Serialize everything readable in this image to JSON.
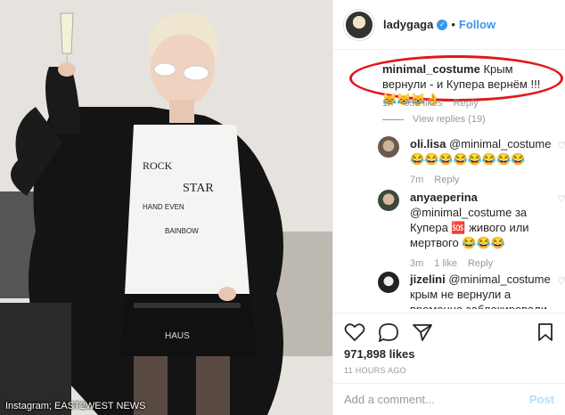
{
  "photo": {
    "credit": "Instagram; EAST2WEST NEWS"
  },
  "header": {
    "username": "ladygaga",
    "separator": "•",
    "follow_label": "Follow"
  },
  "comments": {
    "first": {
      "username": "minimal_costume",
      "text": "Крым вернули - и Купера вернём !!! 😹😹😹👌",
      "time": "1h",
      "likes": "552 likes",
      "reply": "Reply"
    },
    "view_replies": "View replies (19)",
    "replies": [
      {
        "username": "oli.lisa",
        "text": "@minimal_costume 😂😂😂😂😂😂😂😂",
        "time": "7m",
        "likes": "",
        "reply": "Reply"
      },
      {
        "username": "anyaeperina",
        "text": "@minimal_costume за Купера 🆘 живого или мертвого 😂😂😂",
        "time": "3m",
        "likes": "1 like",
        "reply": "Reply"
      },
      {
        "username": "jizelini",
        "text": "@minimal_costume крым не вернули а временно заблокировали",
        "time": "",
        "likes": "",
        "reply": ""
      }
    ]
  },
  "actions": {
    "likes_total": "971,898 likes",
    "timestamp": "11 HOURS AGO"
  },
  "add_comment": {
    "placeholder": "Add a comment...",
    "post_label": "Post"
  },
  "colors": {
    "accent": "#3897f0",
    "highlight_oval": "#e3171b",
    "post_disabled": "#b2dffc"
  }
}
